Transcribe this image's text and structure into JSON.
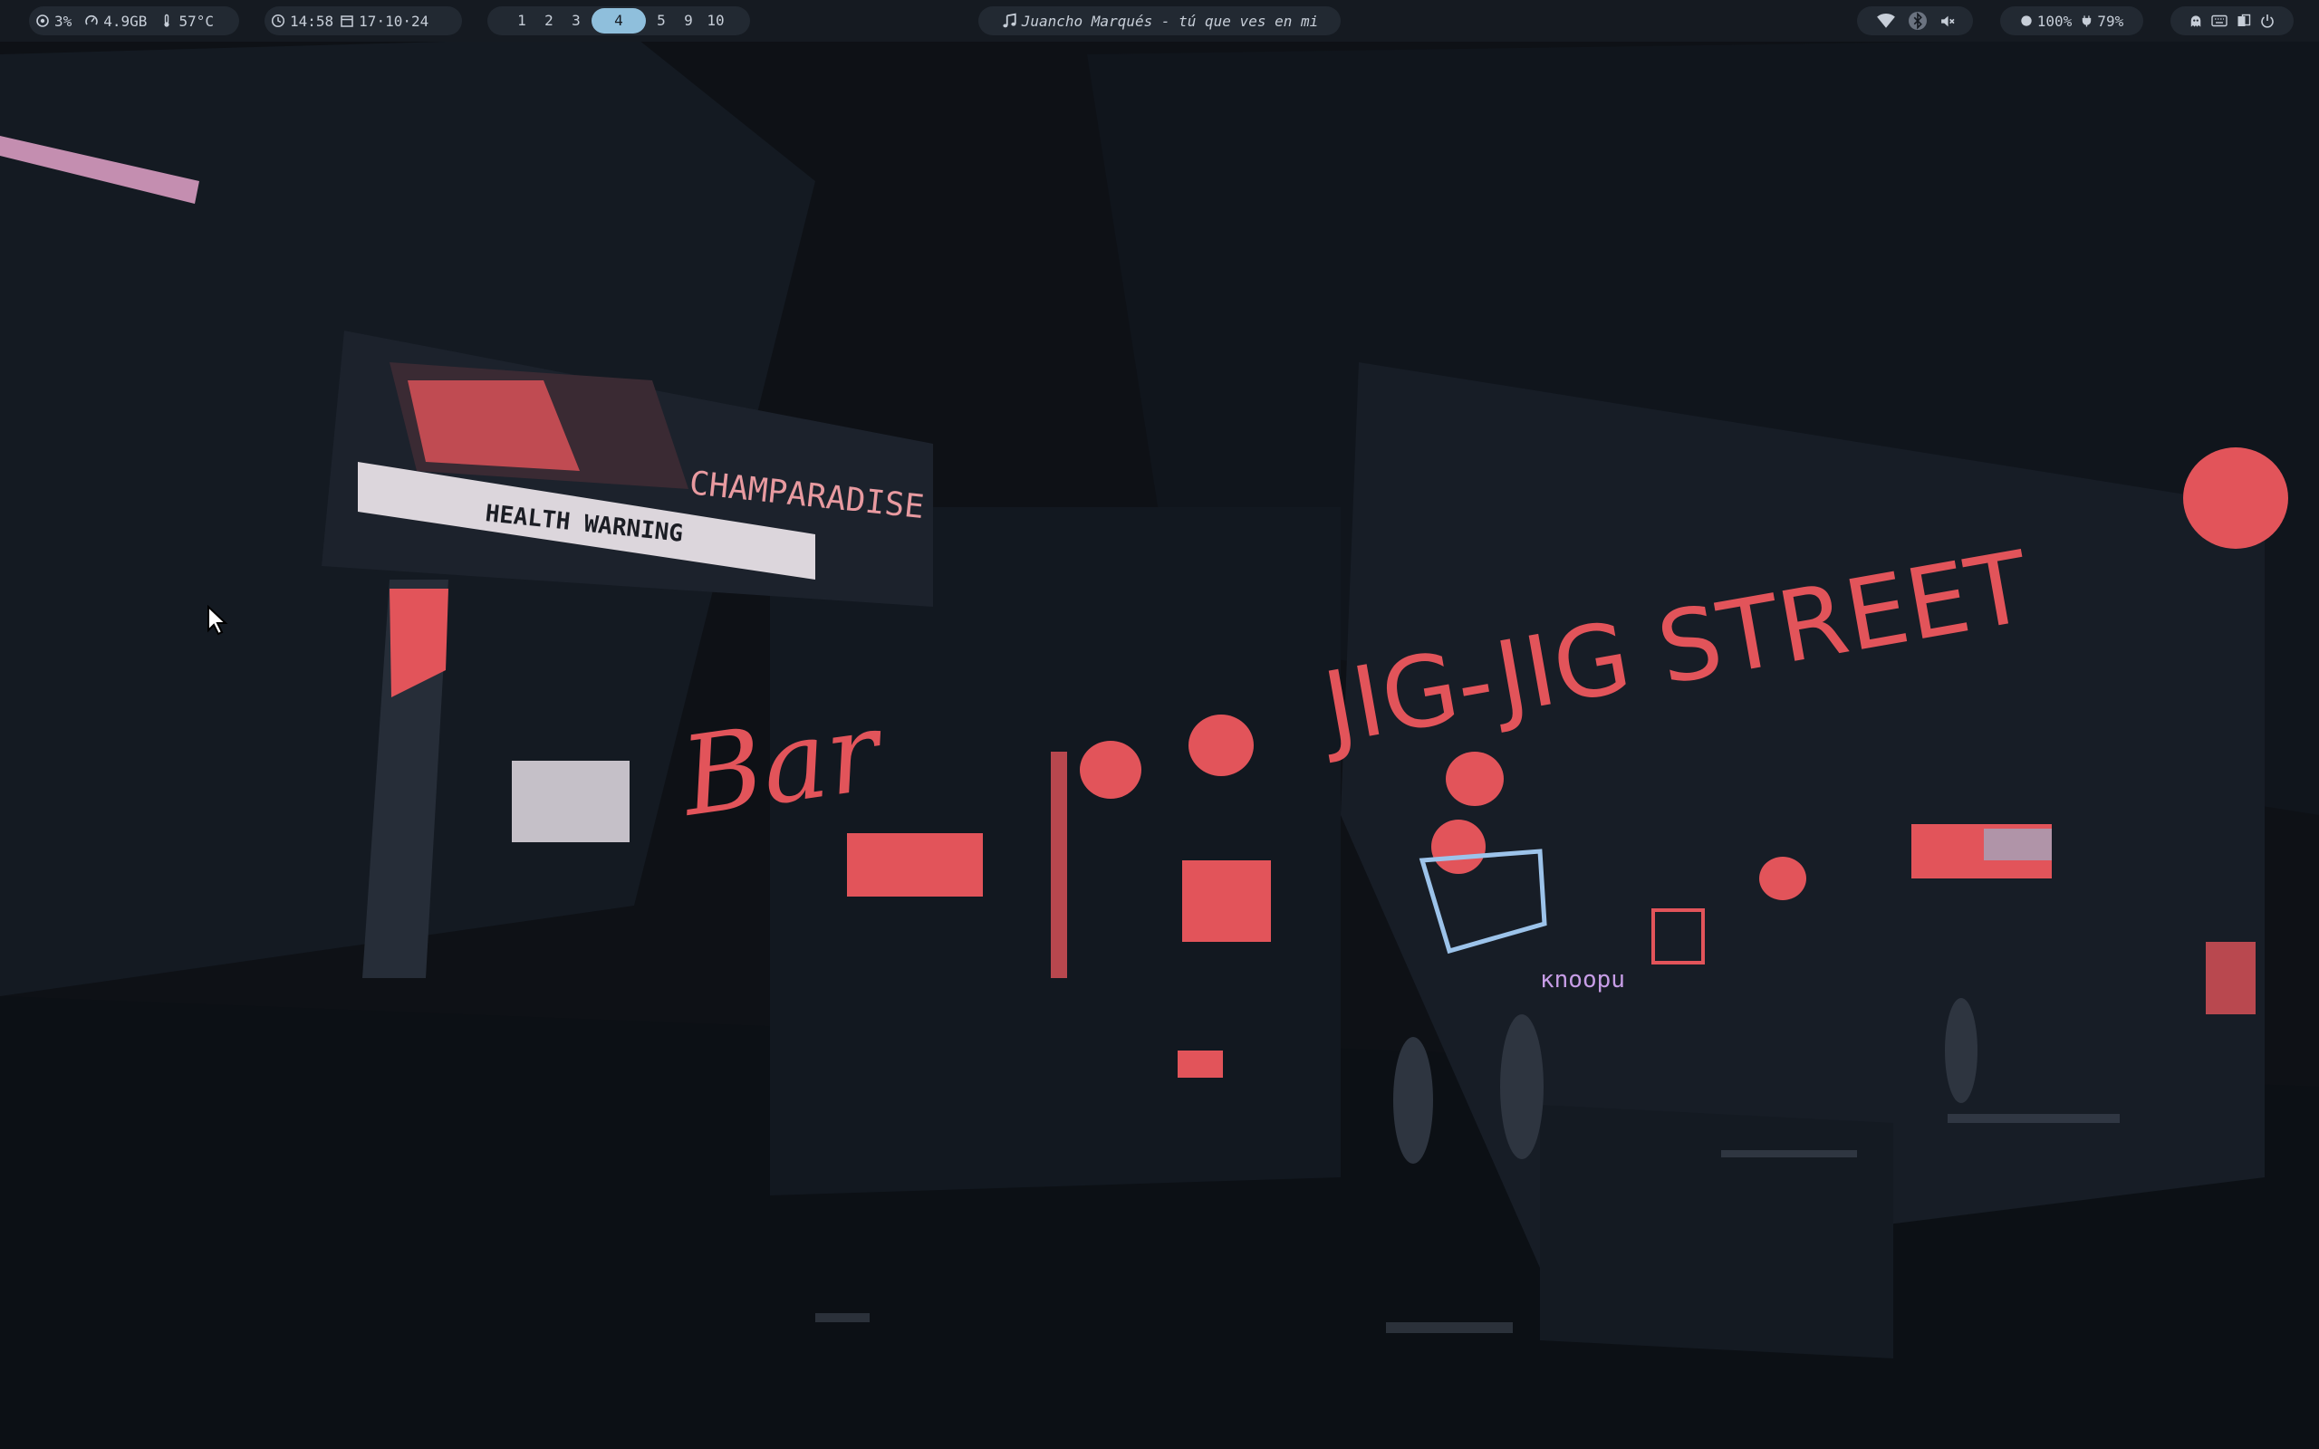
{
  "system": {
    "cpu": "3%",
    "memory": "4.9GB",
    "temperature": "57°C"
  },
  "clock": {
    "time": "14:58",
    "date": "17·10·24"
  },
  "workspaces": [
    {
      "label": "1",
      "active": false
    },
    {
      "label": "2",
      "active": false
    },
    {
      "label": "3",
      "active": false
    },
    {
      "label": "4",
      "active": true
    },
    {
      "label": "5",
      "active": false
    },
    {
      "label": "9",
      "active": false
    },
    {
      "label": "10",
      "active": false
    }
  ],
  "media": {
    "now_playing": "Juancho Marqués - tú que ves en mi",
    "icon": "music-note-icon"
  },
  "network": {
    "icons": [
      "wifi-icon",
      "bluetooth-icon",
      "volume-muted-icon"
    ]
  },
  "power": {
    "brightness": "100%",
    "battery": "79%"
  },
  "tray": {
    "icons": [
      "ghost-icon",
      "keyboard-icon",
      "clipboard-icon",
      "power-icon"
    ]
  },
  "wallpaper": {
    "sign_billboard": "CHAMPARADISE",
    "sign_billboard_sub": "HEALTH WARNING",
    "sign_street": "JIG-JIG STREET",
    "sign_bar": "Bar"
  },
  "colors": {
    "bar_bg": "#151a21",
    "pill_bg": "#222932",
    "accent": "#8fbfdc",
    "text": "#c7ced8",
    "neon_red": "#e2545a"
  }
}
